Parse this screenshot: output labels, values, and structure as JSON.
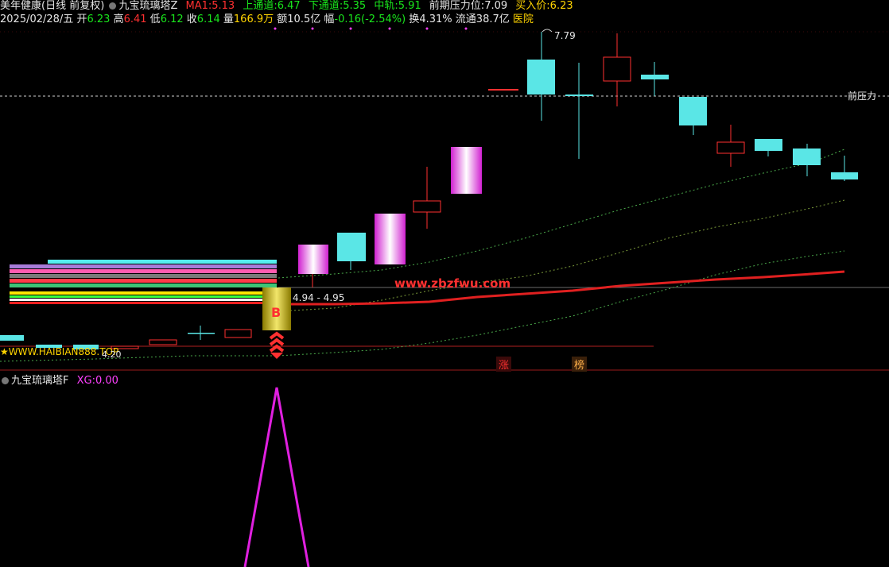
{
  "header": {
    "stock_name": "美年健康",
    "period": "(日线 前复权)",
    "indicator_name": "九宝琉璃塔Z",
    "ma1_label": "MA1:",
    "ma1_value": "5.13",
    "upper_label": "上通道:",
    "upper_value": "6.47",
    "lower_label": "下通道:",
    "lower_value": "5.35",
    "mid_label": "中轨:",
    "mid_value": "5.91",
    "pressure_label": "前期压力位:",
    "pressure_value": "7.09",
    "buy_label": "买入价:",
    "buy_value": "6.23"
  },
  "quote": {
    "date": "2025/02/28/五",
    "open_label": "开",
    "open": "6.23",
    "high_label": "高",
    "high": "6.41",
    "low_label": "低",
    "low": "6.12",
    "close_label": "收",
    "close": "6.14",
    "vol_label": "量",
    "vol": "166.9万",
    "amount_label": "额",
    "amount": "10.5亿",
    "change_label": "幅",
    "change": "-0.16(-2.54%)",
    "turnover_label": "换",
    "turnover": "4.31%",
    "float_label": "流通",
    "float": "38.7亿",
    "sector": "医院"
  },
  "main_chart": {
    "high_marker": "7.79",
    "low_marker": "4.20",
    "pressure_line_label": "前压力",
    "price_range_label": "4.94 - 4.95",
    "buy_signal": "B",
    "watermark_site": "www.zbzfwu.com",
    "watermark_left": "★WWW.HAIBIAN888.TOP",
    "tag_zhang": "涨",
    "tag_bang": "榜"
  },
  "lower_panel": {
    "indicator_name": "九宝琉璃塔F",
    "xg_label": "XG:",
    "xg_value": "0.00"
  },
  "colors": {
    "up": "#ff3030",
    "down": "#5ae6e6",
    "grid": "#8a1a1a",
    "pressure_line": "#cfcfcf",
    "magenta": "#ff40ff"
  }
}
